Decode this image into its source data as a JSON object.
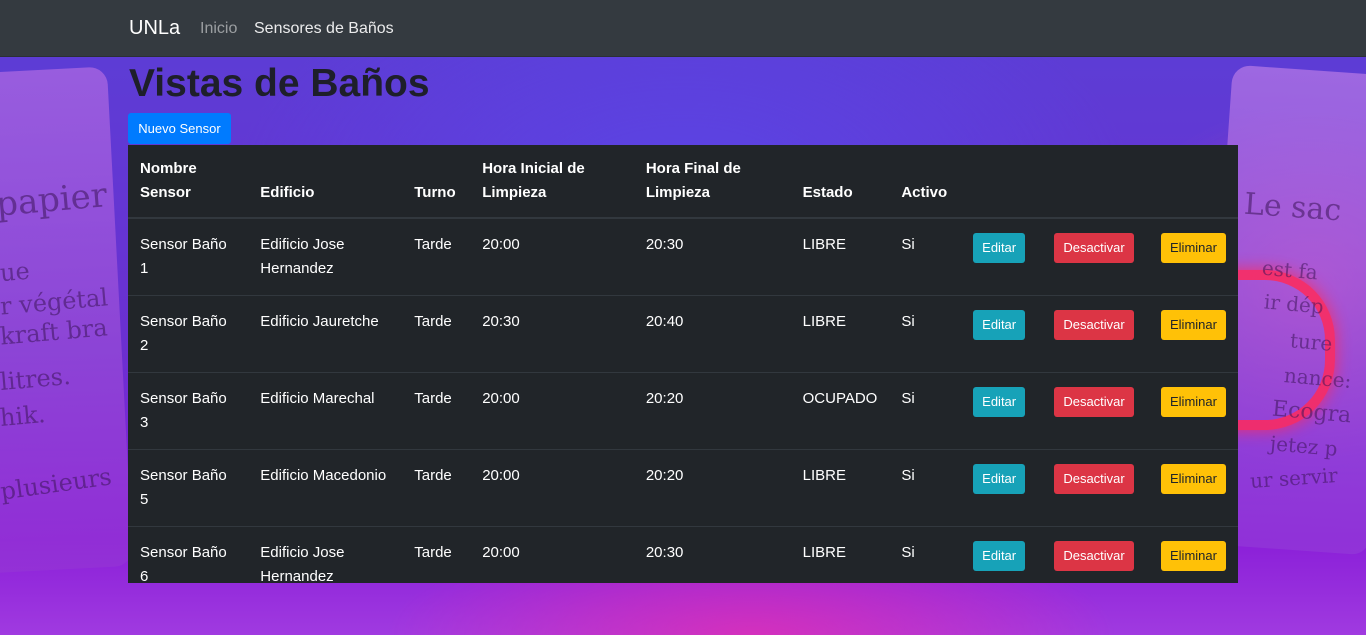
{
  "navbar": {
    "brand": "UNLa",
    "links": [
      "Inicio",
      "Sensores de Baños"
    ]
  },
  "page": {
    "title": "Vistas de Baños",
    "new_button": "Nuevo Sensor"
  },
  "table": {
    "headers": [
      "Nombre Sensor",
      "Edificio",
      "Turno",
      "Hora Inicial de Limpieza",
      "Hora Final de Limpieza",
      "Estado",
      "Activo"
    ],
    "rows": [
      {
        "nombre": "Sensor Baño 1",
        "edificio": "Edificio Jose Hernandez",
        "turno": "Tarde",
        "inicio": "20:00",
        "fin": "20:30",
        "estado": "LIBRE",
        "activo": "Si"
      },
      {
        "nombre": "Sensor Baño 2",
        "edificio": "Edificio Jauretche",
        "turno": "Tarde",
        "inicio": "20:30",
        "fin": "20:40",
        "estado": "LIBRE",
        "activo": "Si"
      },
      {
        "nombre": "Sensor Baño 3",
        "edificio": "Edificio Marechal",
        "turno": "Tarde",
        "inicio": "20:00",
        "fin": "20:20",
        "estado": "OCUPADO",
        "activo": "Si"
      },
      {
        "nombre": "Sensor Baño 5",
        "edificio": "Edificio Macedonio",
        "turno": "Tarde",
        "inicio": "20:00",
        "fin": "20:20",
        "estado": "LIBRE",
        "activo": "Si"
      },
      {
        "nombre": "Sensor Baño 6",
        "edificio": "Edificio Jose Hernandez",
        "turno": "Tarde",
        "inicio": "20:00",
        "fin": "20:30",
        "estado": "LIBRE",
        "activo": "Si"
      }
    ],
    "actions": {
      "edit": "Editar",
      "deactivate": "Desactivar",
      "delete": "Eliminar"
    }
  },
  "background": {
    "left_words": [
      "papier",
      "ue",
      "r végétal",
      "kraft bra",
      "litres.",
      "hik.",
      "plusieurs"
    ],
    "right_words": [
      "Le sac",
      "est fa",
      "ir dép",
      "ture",
      "nance:",
      "Ecogra",
      "jetez p",
      "ur servir"
    ]
  },
  "colors": {
    "navbar": "#343a40",
    "table": "#212529",
    "primary": "#007bff",
    "info": "#17a2b8",
    "danger": "#dc3545",
    "warning": "#ffc107"
  }
}
